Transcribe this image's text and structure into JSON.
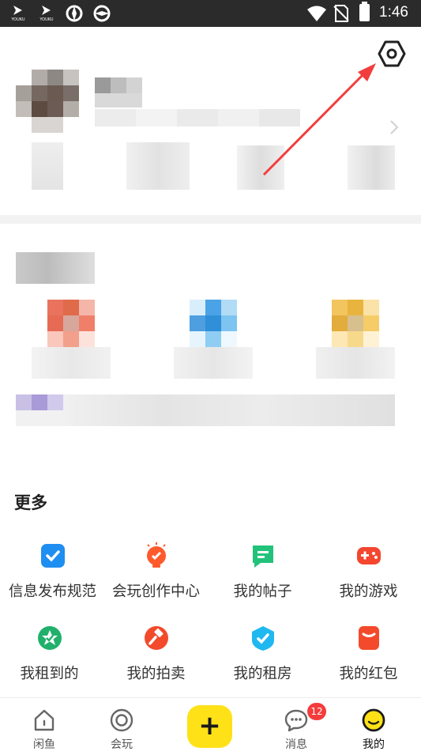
{
  "status_bar": {
    "app_labels": [
      "YOUKU",
      "YOUKU"
    ],
    "time": "1:46",
    "colors": {
      "background": "#2b2b2b"
    }
  },
  "profile": {
    "settings_icon": "settings-hexagon-icon",
    "content_state": "pixelated"
  },
  "more": {
    "title": "更多",
    "items": [
      {
        "label": "信息发布规范",
        "icon": "check-badge-icon",
        "color": "#1f8ef1"
      },
      {
        "label": "会玩创作中心",
        "icon": "bulb-icon",
        "color": "#ff5a2c"
      },
      {
        "label": "我的帖子",
        "icon": "chat-note-icon",
        "color": "#22c27a"
      },
      {
        "label": "我的游戏",
        "icon": "gamepad-icon",
        "color": "#f5462f"
      },
      {
        "label": "我租到的",
        "icon": "star-circle-icon",
        "color": "#21b06b"
      },
      {
        "label": "我的拍卖",
        "icon": "gavel-icon",
        "color": "#f34a2c"
      },
      {
        "label": "我的租房",
        "icon": "shield-check-icon",
        "color": "#20b8f0"
      },
      {
        "label": "我的红包",
        "icon": "red-envelope-icon",
        "color": "#f34a2c"
      }
    ]
  },
  "tabbar": {
    "tabs": [
      {
        "label": "闲鱼",
        "icon": "home-icon"
      },
      {
        "label": "会玩",
        "icon": "target-icon"
      },
      {
        "label": "消息",
        "icon": "message-icon"
      },
      {
        "label": "我的",
        "icon": "profile-face-icon"
      }
    ],
    "publish_symbol": "+",
    "message_badge": "12",
    "accent": "#ffe118"
  }
}
